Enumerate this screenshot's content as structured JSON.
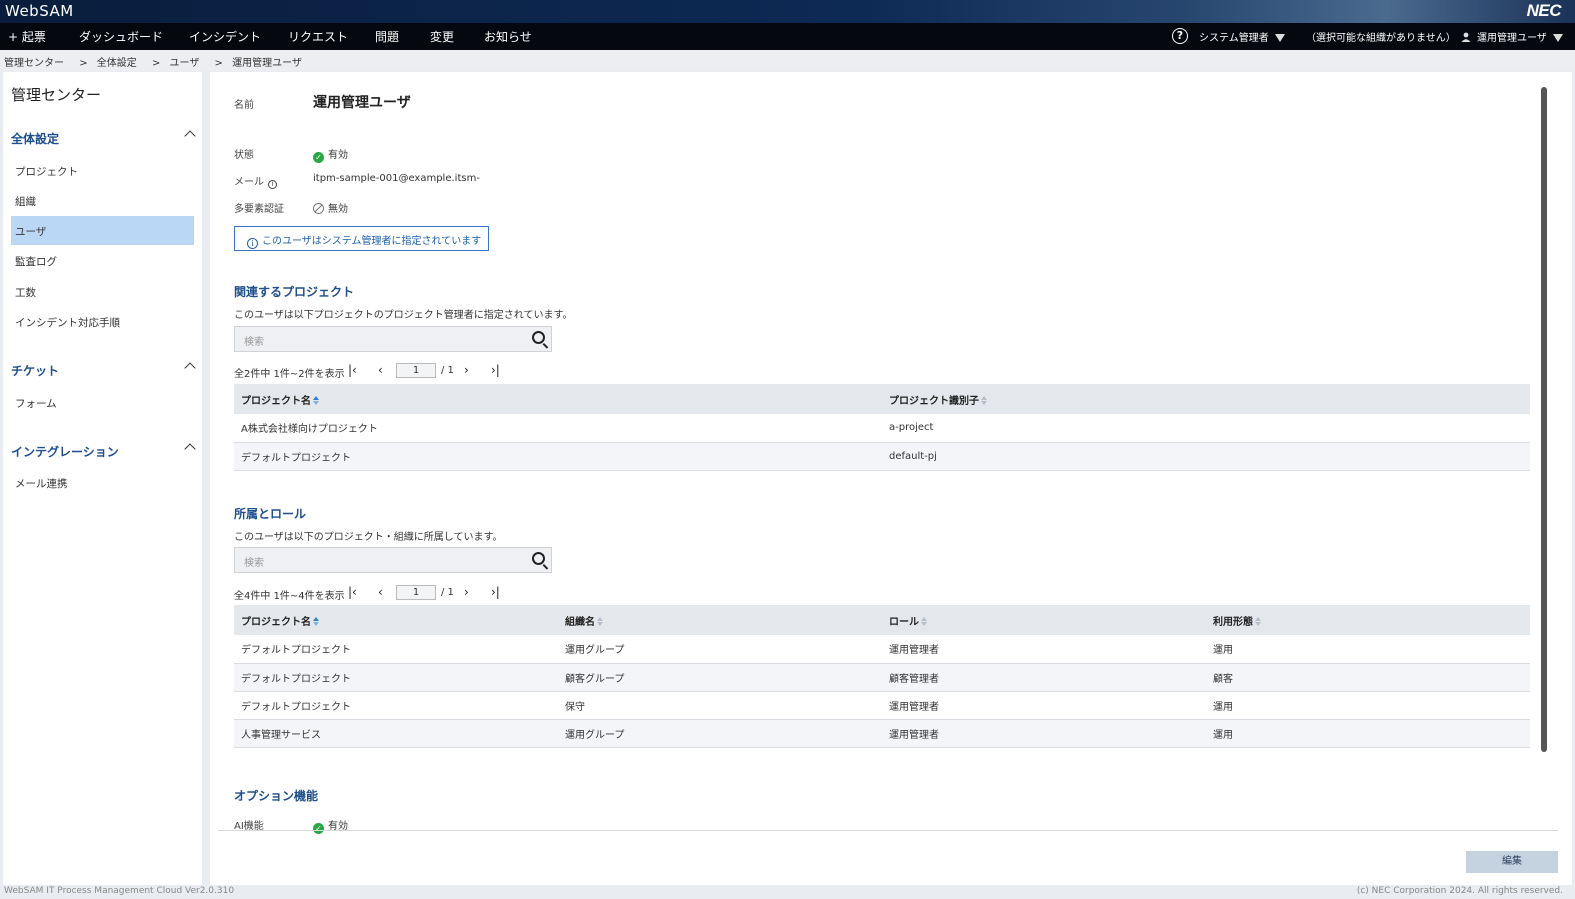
{
  "app": {
    "brand": "WebSAM",
    "vendor_logo": "NEC"
  },
  "nav": {
    "create": "+ 起票",
    "items": [
      "ダッシュボード",
      "インシデント",
      "リクエスト",
      "問題",
      "変更",
      "お知らせ"
    ],
    "help_icon": "?",
    "role": "システム管理者",
    "org": "（選択可能な組織がありません）",
    "user": "運用管理ユーザ"
  },
  "breadcrumb": [
    "管理センター",
    ">",
    "全体設定",
    ">",
    "ユーザ",
    ">",
    "運用管理ユーザ"
  ],
  "sidebar": {
    "title": "管理センター",
    "sections": [
      {
        "label": "全体設定",
        "items": [
          "プロジェクト",
          "組織",
          "ユーザ",
          "監査ログ",
          "工数",
          "インシデント対応手順"
        ]
      },
      {
        "label": "チケット",
        "items": [
          "フォーム"
        ]
      },
      {
        "label": "インテグレーション",
        "items": [
          "メール連携"
        ]
      }
    ],
    "active_item": "ユーザ"
  },
  "detail": {
    "name_label": "名前",
    "name_value": "運用管理ユーザ",
    "status_label": "状態",
    "status_value": "有効",
    "mail_label": "メール",
    "mail_value": "itpm-sample-001@example.itsm-",
    "mfa_label": "多要素認証",
    "mfa_value": "無効",
    "notice": "このユーザはシステム管理者に指定されています"
  },
  "projects": {
    "title": "関連するプロジェクト",
    "desc": "このユーザは以下プロジェクトのプロジェクト管理者に指定されています。",
    "search_placeholder": "検索",
    "pager_text": "全2件中 1件~2件を表示",
    "page": "1",
    "total_pages": "/ 1",
    "columns": [
      "プロジェクト名",
      "プロジェクト識別子"
    ],
    "rows": [
      [
        "A株式会社様向けプロジェクト",
        "a-project"
      ],
      [
        "デフォルトプロジェクト",
        "default-pj"
      ]
    ]
  },
  "roles": {
    "title": "所属とロール",
    "desc": "このユーザは以下のプロジェクト・組織に所属しています。",
    "search_placeholder": "検索",
    "pager_text": "全4件中 1件~4件を表示",
    "page": "1",
    "total_pages": "/ 1",
    "columns": [
      "プロジェクト名",
      "組織名",
      "ロール",
      "利用形態"
    ],
    "rows": [
      [
        "デフォルトプロジェクト",
        "運用グループ",
        "運用管理者",
        "運用"
      ],
      [
        "デフォルトプロジェクト",
        "顧客グループ",
        "顧客管理者",
        "顧客"
      ],
      [
        "デフォルトプロジェクト",
        "保守",
        "運用管理者",
        "運用"
      ],
      [
        "人事管理サービス",
        "運用グループ",
        "運用管理者",
        "運用"
      ]
    ]
  },
  "options": {
    "title": "オプション機能",
    "ai_label": "AI機能",
    "ai_value": "有効"
  },
  "edit_button": "編集",
  "footer": {
    "left": "WebSAM IT Process Management Cloud Ver2.0.310",
    "right": "(c) NEC Corporation 2024. All rights reserved."
  },
  "colors": {
    "accent": "#1f4e8c",
    "active_bg": "#bad8f5",
    "success": "#27a844",
    "nav_bg": "#05080f"
  }
}
